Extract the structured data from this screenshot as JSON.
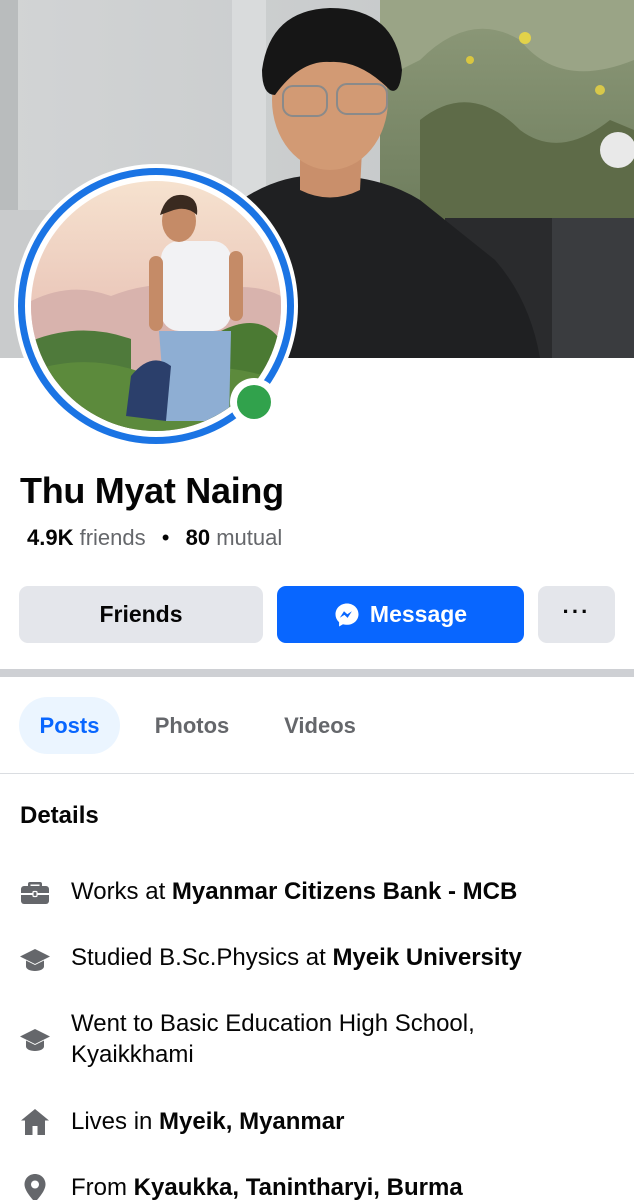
{
  "profile": {
    "name": "Thu Myat Naing",
    "friends_count": "4.9K",
    "friends_label": "friends",
    "separator": "•",
    "mutual_count": "80",
    "mutual_label": "mutual",
    "online": true
  },
  "actions": {
    "friends_label": "Friends",
    "message_label": "Message",
    "more_label": "···"
  },
  "tabs": [
    {
      "label": "Posts",
      "active": true
    },
    {
      "label": "Photos",
      "active": false
    },
    {
      "label": "Videos",
      "active": false
    }
  ],
  "details": {
    "title": "Details",
    "items": [
      {
        "icon": "briefcase-icon",
        "prefix": "Works at ",
        "bold": "Myanmar Citizens Bank - MCB",
        "text2": ""
      },
      {
        "icon": "graduation-cap-icon",
        "prefix": "Studied B.Sc.Physics at ",
        "bold": "Myeik University",
        "text2": ""
      },
      {
        "icon": "graduation-cap-icon",
        "prefix": "Went to Basic Education High School, Kyaikkhami",
        "bold": "",
        "text2": ""
      },
      {
        "icon": "home-icon",
        "prefix": "Lives in ",
        "bold": "Myeik, Myanmar",
        "text2": ""
      },
      {
        "icon": "location-pin-icon",
        "prefix": "From ",
        "bold": "Kyaukka, Tanintharyi, Burma",
        "text2": ""
      }
    ]
  },
  "colors": {
    "accent": "#0866ff",
    "ring": "#1b74e4",
    "online": "#31a24c",
    "button_gray": "#e4e6eb",
    "tab_active_bg": "#ebf5ff",
    "secondary_text": "#65676b",
    "icon_gray": "#65676b"
  }
}
